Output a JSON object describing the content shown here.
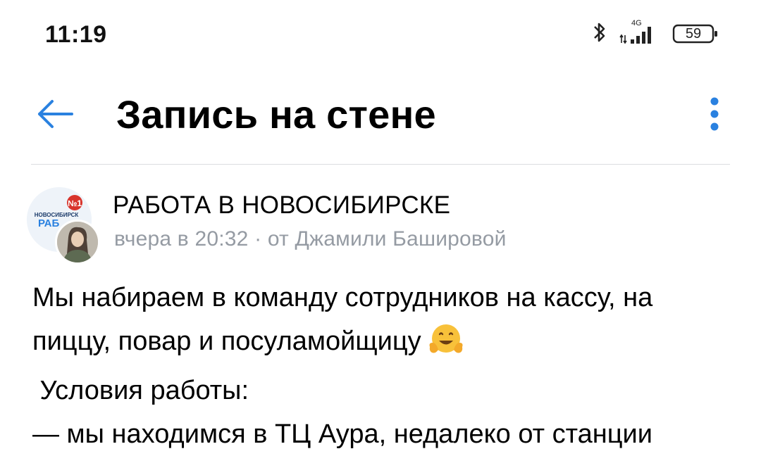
{
  "status_bar": {
    "time": "11:19",
    "network_label": "4G",
    "battery": "59"
  },
  "header": {
    "title": "Запись на стене"
  },
  "post": {
    "group_name": "РАБОТА В НОВОСИБИРСКЕ",
    "meta": "вчера в 20:32 · от Джамили Башировой",
    "avatar_text": "НОВОСИБИРСК РАБО",
    "avatar_badge": "№1",
    "lines": [
      "Мы набираем в команду сотрудников на кассу, на",
      "пиццу, повар и посуламойщицу",
      " Условия работы:",
      "— мы находимся в ТЦ Аура, недалеко от станции"
    ]
  },
  "colors": {
    "accent": "#2a81e0",
    "meta_text": "#959ba3",
    "divider": "#dcdde0"
  },
  "icons": {
    "back": "arrow-left-icon",
    "more": "more-vertical-icon",
    "bluetooth": "bluetooth-icon",
    "signal": "signal-icon",
    "battery": "battery-icon",
    "emoji": "hugging-face-emoji"
  }
}
